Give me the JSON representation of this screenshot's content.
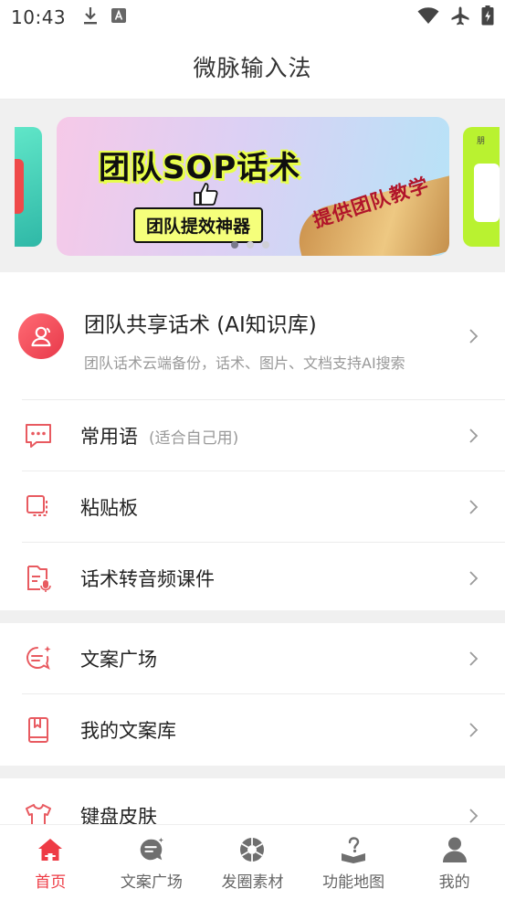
{
  "status_bar": {
    "time": "10:43"
  },
  "app": {
    "title": "微脉输入法"
  },
  "banner": {
    "title": "团队SOP话术",
    "subtitle": "团队提效神器",
    "gold_text": "提供团队教学",
    "right_peek_text": "朋",
    "page_count": 3,
    "active_index": 0
  },
  "feature": {
    "title": "团队共享话术 (AI知识库)",
    "description": "团队话术云端备份，话术、图片、文档支持AI搜索"
  },
  "group1": [
    {
      "label": "常用语",
      "hint": "(适合自己用)",
      "icon": "chat-dots-icon"
    },
    {
      "label": "粘贴板",
      "hint": "",
      "icon": "clipboard-icon"
    },
    {
      "label": "话术转音频课件",
      "hint": "",
      "icon": "audio-file-icon"
    }
  ],
  "group2": [
    {
      "label": "文案广场",
      "icon": "sparkle-chat-icon"
    },
    {
      "label": "我的文案库",
      "icon": "book-icon"
    }
  ],
  "group3": [
    {
      "label": "键盘皮肤",
      "icon": "shirt-icon"
    }
  ],
  "bottom_nav": [
    {
      "label": "首页",
      "icon": "home-icon",
      "active": true
    },
    {
      "label": "文案广场",
      "icon": "chat-bubble-icon",
      "active": false
    },
    {
      "label": "发圈素材",
      "icon": "aperture-icon",
      "active": false
    },
    {
      "label": "功能地图",
      "icon": "question-book-icon",
      "active": false
    },
    {
      "label": "我的",
      "icon": "user-icon",
      "active": false
    }
  ],
  "colors": {
    "accent": "#EE3B45",
    "icon_red": "#E85A60",
    "muted": "#999999"
  }
}
